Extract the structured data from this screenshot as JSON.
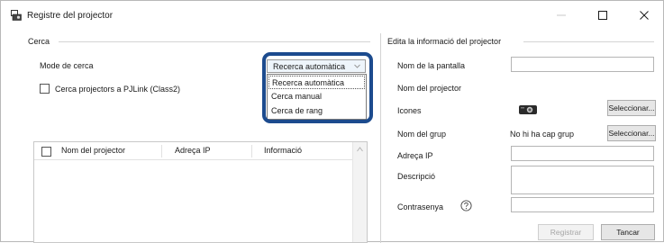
{
  "window": {
    "title": "Registre del projector",
    "controls": {
      "minimize": "—",
      "maximize": "☐",
      "close": "✕"
    }
  },
  "search": {
    "group_title": "Cerca",
    "mode_label": "Mode de cerca",
    "mode_value": "Recerca automàtica",
    "mode_options": [
      "Recerca automàtica",
      "Cerca manual",
      "Cerca de rang"
    ],
    "pjlink_label": "Cerca projectors a PJLink (Class2)",
    "pjlink_checked": false
  },
  "table": {
    "columns": [
      "Nom del projector",
      "Adreça IP",
      "Informació"
    ],
    "rows": []
  },
  "edit": {
    "group_title": "Edita la informació del projector",
    "screen_name_label": "Nom de la pantalla",
    "screen_name_value": "",
    "projector_name_label": "Nom del projector",
    "icons_label": "Icones",
    "select_button": "Seleccionar...",
    "group_name_label": "Nom del grup",
    "group_name_value": "No hi ha cap grup",
    "select_group_button": "Seleccionar...",
    "ip_label": "Adreça IP",
    "ip_value": "",
    "description_label": "Descripció",
    "description_value": "",
    "password_label": "Contrasenya",
    "password_value": ""
  },
  "footer": {
    "register_button": "Registrar",
    "close_button": "Tancar"
  },
  "colors": {
    "highlight": "#1c4b8e",
    "combo_bg": "#eef5fb",
    "button_bg": "#e6e6e6"
  },
  "icons": {
    "app": "projector-registry-icon",
    "projector": "projector-icon",
    "help": "help-icon"
  }
}
